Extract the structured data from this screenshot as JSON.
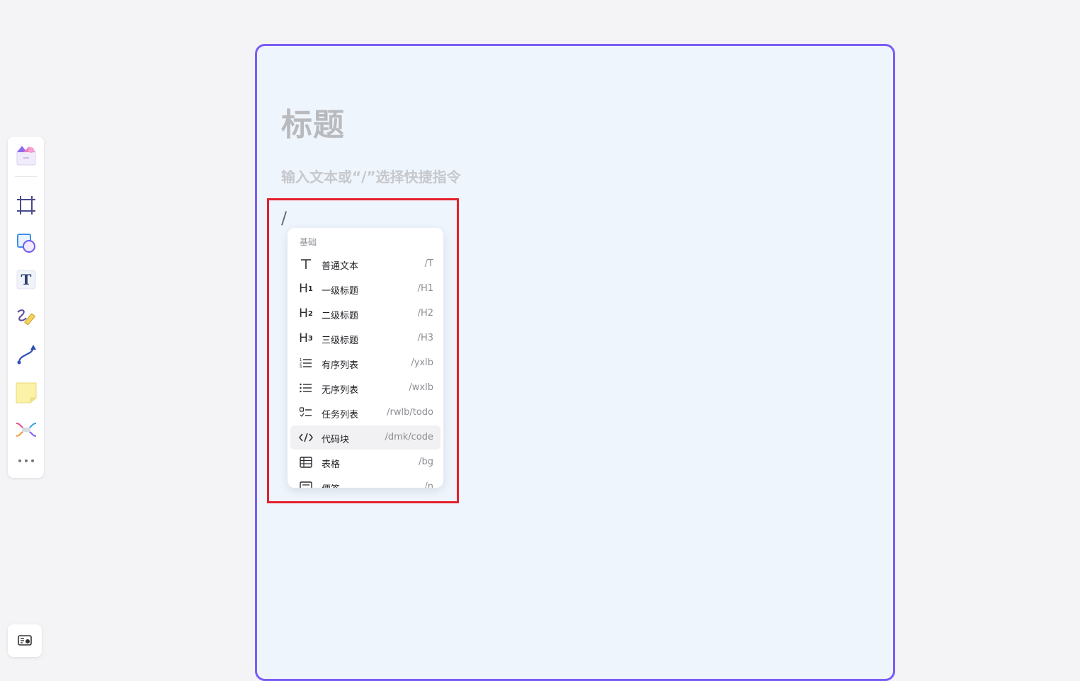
{
  "document": {
    "title": "标题",
    "placeholder": "输入文本或“/”选择快捷指令",
    "typed_text": "/"
  },
  "slash_menu": {
    "group_label": "基础",
    "items": [
      {
        "label": "普通文本",
        "shortcut": "/T",
        "icon": "text-t-icon"
      },
      {
        "label": "一级标题",
        "shortcut": "/H1",
        "icon": "heading-1-icon"
      },
      {
        "label": "二级标题",
        "shortcut": "/H2",
        "icon": "heading-2-icon"
      },
      {
        "label": "三级标题",
        "shortcut": "/H3",
        "icon": "heading-3-icon"
      },
      {
        "label": "有序列表",
        "shortcut": "/yxlb",
        "icon": "ordered-list-icon"
      },
      {
        "label": "无序列表",
        "shortcut": "/wxlb",
        "icon": "bullet-list-icon"
      },
      {
        "label": "任务列表",
        "shortcut": "/rwlb/todo",
        "icon": "task-list-icon"
      },
      {
        "label": "代码块",
        "shortcut": "/dmk/code",
        "icon": "code-block-icon"
      },
      {
        "label": "表格",
        "shortcut": "/bg",
        "icon": "table-icon"
      },
      {
        "label": "便签",
        "shortcut": "/n",
        "icon": "sticky-note-icon"
      }
    ],
    "active_index": 7
  },
  "toolbar": {
    "tools": [
      "template-icon",
      "frame-icon",
      "shape-icon",
      "text-tool-icon",
      "pen-icon",
      "connector-icon",
      "sticky-note-icon",
      "mindmap-icon",
      "more-icon"
    ]
  },
  "colors": {
    "frame_border": "#7b5cf5",
    "highlight_border": "#e5202b",
    "doc_background": "#eff5fd"
  }
}
